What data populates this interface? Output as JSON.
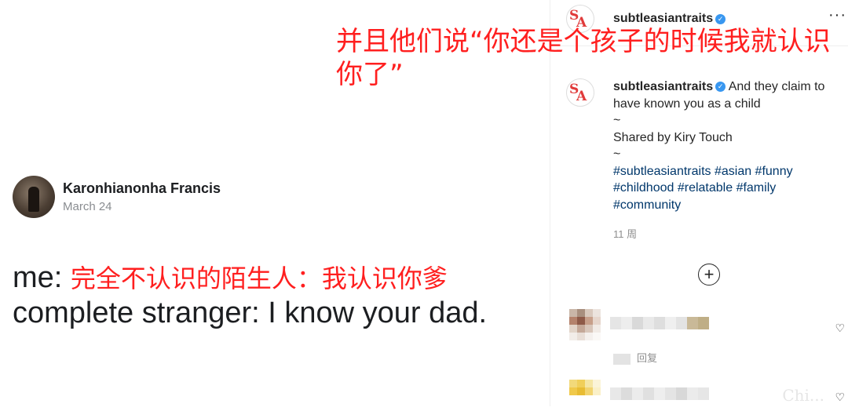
{
  "overlay_caption": "并且他们说“你还是个孩子的时候我就认识你了”",
  "meme": {
    "author_name": "Karonhianonha Francis",
    "date": "March 24",
    "line1_prefix": "me: ",
    "line1_chinese": "完全不认识的陌生人：我认识你爹",
    "line2": "complete stranger: I know your dad."
  },
  "post": {
    "username": "subtleasiantraits",
    "more_label": "···",
    "caption": "And they claim to have known you as a child",
    "tilde": "~",
    "shared_by": "Shared by Kiry Touch",
    "hashtags": "#subtleasiantraits #asian #funny #childhood #relatable #family #community",
    "time_ago": "11 周",
    "add_comment_label": "+"
  },
  "comments": {
    "reply_label": "回复",
    "heart_icon": "heart-icon"
  },
  "watermark": "Chi..."
}
